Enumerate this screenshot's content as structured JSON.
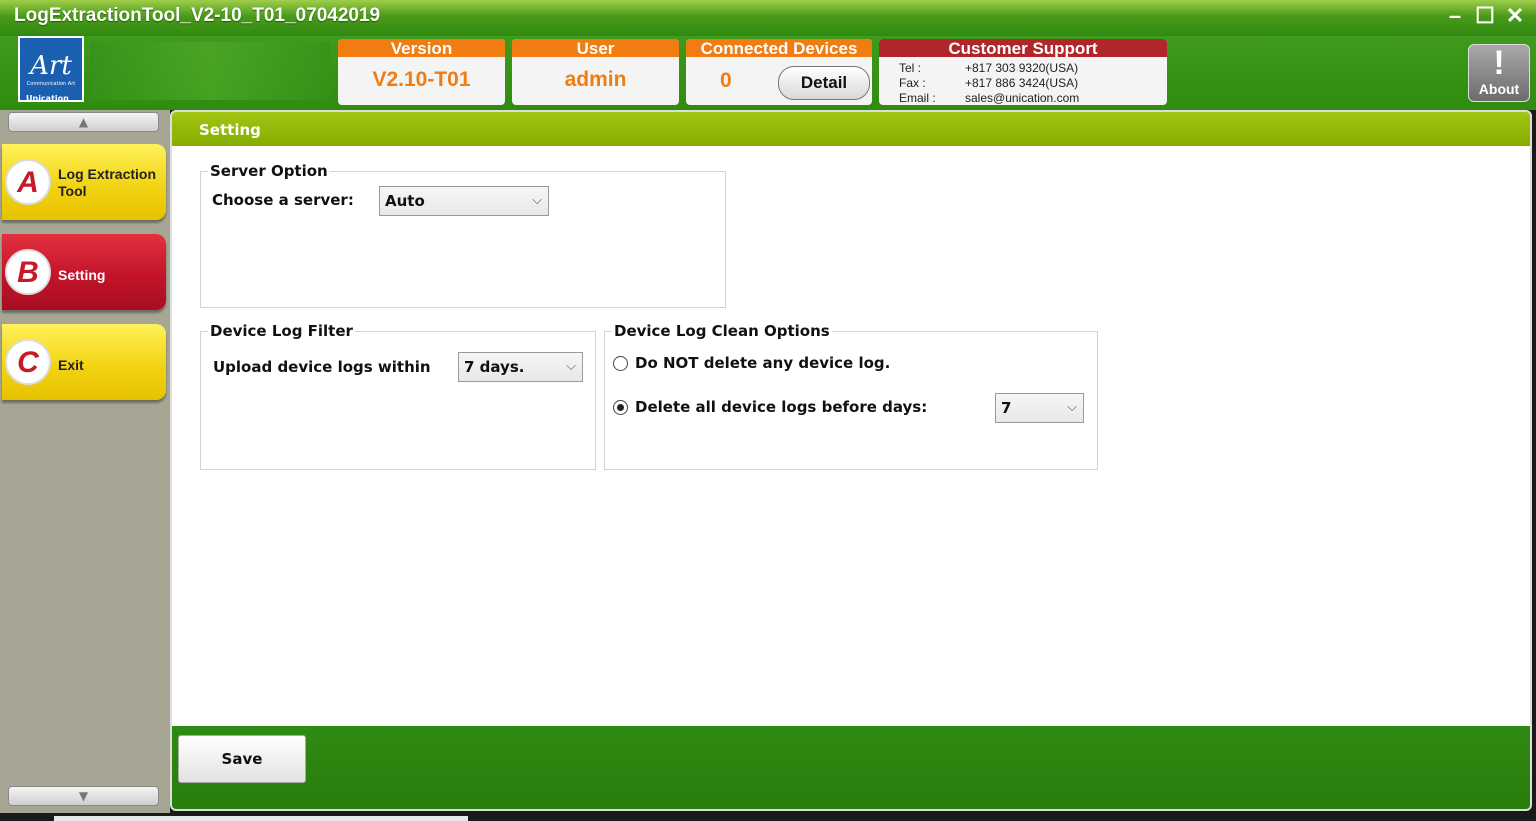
{
  "window": {
    "title": "LogExtractionTool_V2-10_T01_07042019",
    "controls": {
      "minimize": "–",
      "maximize": "☐",
      "close": "✕"
    }
  },
  "header": {
    "logo_mark": "Art",
    "logo_caption": "Communication Art",
    "logo_under": "Unication",
    "version": {
      "label": "Version",
      "value": "V2.10-T01"
    },
    "user": {
      "label": "User",
      "value": "admin"
    },
    "devices": {
      "label": "Connected Devices",
      "count": "0",
      "detail_button": "Detail"
    },
    "support": {
      "label": "Customer Support",
      "tel_key": "Tel :",
      "tel": "+817 303 9320(USA)",
      "fax_key": "Fax :",
      "fax": "+817 886 3424(USA)",
      "email_key": "Email :",
      "email": "sales@unication.com"
    },
    "about": {
      "glyph": "!",
      "label": "About"
    }
  },
  "sidebar": {
    "scroll_up": "▲",
    "scroll_down": "▼",
    "items": [
      {
        "letter": "A",
        "label": "Log Extraction Tool"
      },
      {
        "letter": "B",
        "label": "Setting"
      },
      {
        "letter": "C",
        "label": "Exit"
      }
    ]
  },
  "main": {
    "title": "Setting",
    "server_option": {
      "legend": "Server Option",
      "choose_label": "Choose a server:",
      "selected": "Auto"
    },
    "log_filter": {
      "legend": "Device Log Filter",
      "upload_label": "Upload device logs within",
      "selected": "7 days."
    },
    "clean_options": {
      "legend": "Device Log Clean Options",
      "option_keep": "Do NOT delete any device log.",
      "option_delete": "Delete all device logs before days:",
      "selected_option": "delete",
      "days_selected": "7"
    },
    "save_button": "Save"
  },
  "colors": {
    "title_green": "#3f9a1e",
    "panel_head": "#86ad00",
    "orange": "#f07c12",
    "support_red": "#b1262a",
    "nav_yellow": "#f2d414",
    "nav_red": "#c2142a",
    "sidebar_bg": "#a7a694"
  },
  "icons": {
    "about": "exclamation-icon",
    "dropdown": "chevron-down-icon",
    "scroll_up": "triangle-up-icon",
    "scroll_down": "triangle-down-icon"
  }
}
